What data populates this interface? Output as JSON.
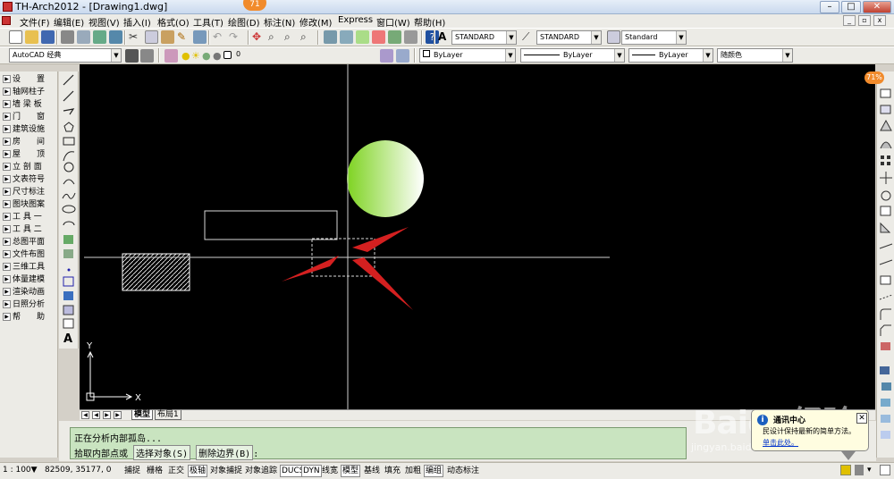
{
  "window": {
    "title": "TH-Arch2012 - [Drawing1.dwg]",
    "badge": "71",
    "minimize": "–",
    "maximize": "□",
    "close": "✕"
  },
  "menu": {
    "items": [
      "文件(F)",
      "编辑(E)",
      "视图(V)",
      "插入(I)",
      "格式(O)",
      "工具(T)",
      "绘图(D)",
      "标注(N)",
      "修改(M)",
      "Express",
      "窗口(W)",
      "帮助(H)"
    ]
  },
  "toolbar": {
    "text_style": "STANDARD",
    "dim_style": "STANDARD",
    "table_style": "Standard",
    "workspace": "AutoCAD 经典",
    "layer": "0",
    "color": "ByLayer",
    "linetype": "ByLayer",
    "lineweight": "ByLayer",
    "plotstyle": "随颜色"
  },
  "th_panel": {
    "items": [
      "设　　置",
      "轴网柱子",
      "墙 梁 板",
      "门　　窗",
      "建筑设施",
      "房　　间",
      "屋　　顶",
      "立 剖 面",
      "文表符号",
      "尺寸标注",
      "图块图案",
      "工 具 一",
      "工 具 二",
      "总图平面",
      "文件布图",
      "三维工具",
      "体量建模",
      "渲染动画",
      "日照分析",
      "帮　　助"
    ]
  },
  "canvas": {
    "ucs_x": "X",
    "ucs_y": "Y",
    "background": "#000000",
    "circle_gradient": [
      "#7ed321",
      "#ffffff"
    ],
    "arrow_color": "#d42020"
  },
  "tabs": {
    "nav": [
      "◀",
      "◀",
      "▶",
      "▶"
    ],
    "items": [
      "模型",
      "布局1"
    ]
  },
  "command": {
    "line1": "正在分析内部孤岛...",
    "prompt": "拾取内部点或",
    "option1": "选择对象(S)",
    "option2": "删除边界(B)",
    "suffix": ":"
  },
  "status": {
    "scale": "1 : 100▼",
    "coords": "82509,  35177, 0",
    "toggles": [
      "捕捉",
      "栅格",
      "正交",
      "极轴",
      "对象捕捉",
      "对象追踪",
      "DUCS",
      "DYN",
      "线宽",
      "模型",
      "基线",
      "填充",
      "加粗",
      "编组",
      "动态标注"
    ]
  },
  "notification": {
    "title": "通讯中心",
    "message": "民设计保持最新的简单方法。",
    "link": "单击此处。",
    "icon": "i",
    "close": "✕"
  },
  "watermark": {
    "main": "Baidu经验",
    "url": "jingyan.baidu.com"
  },
  "side_badge": "71%"
}
